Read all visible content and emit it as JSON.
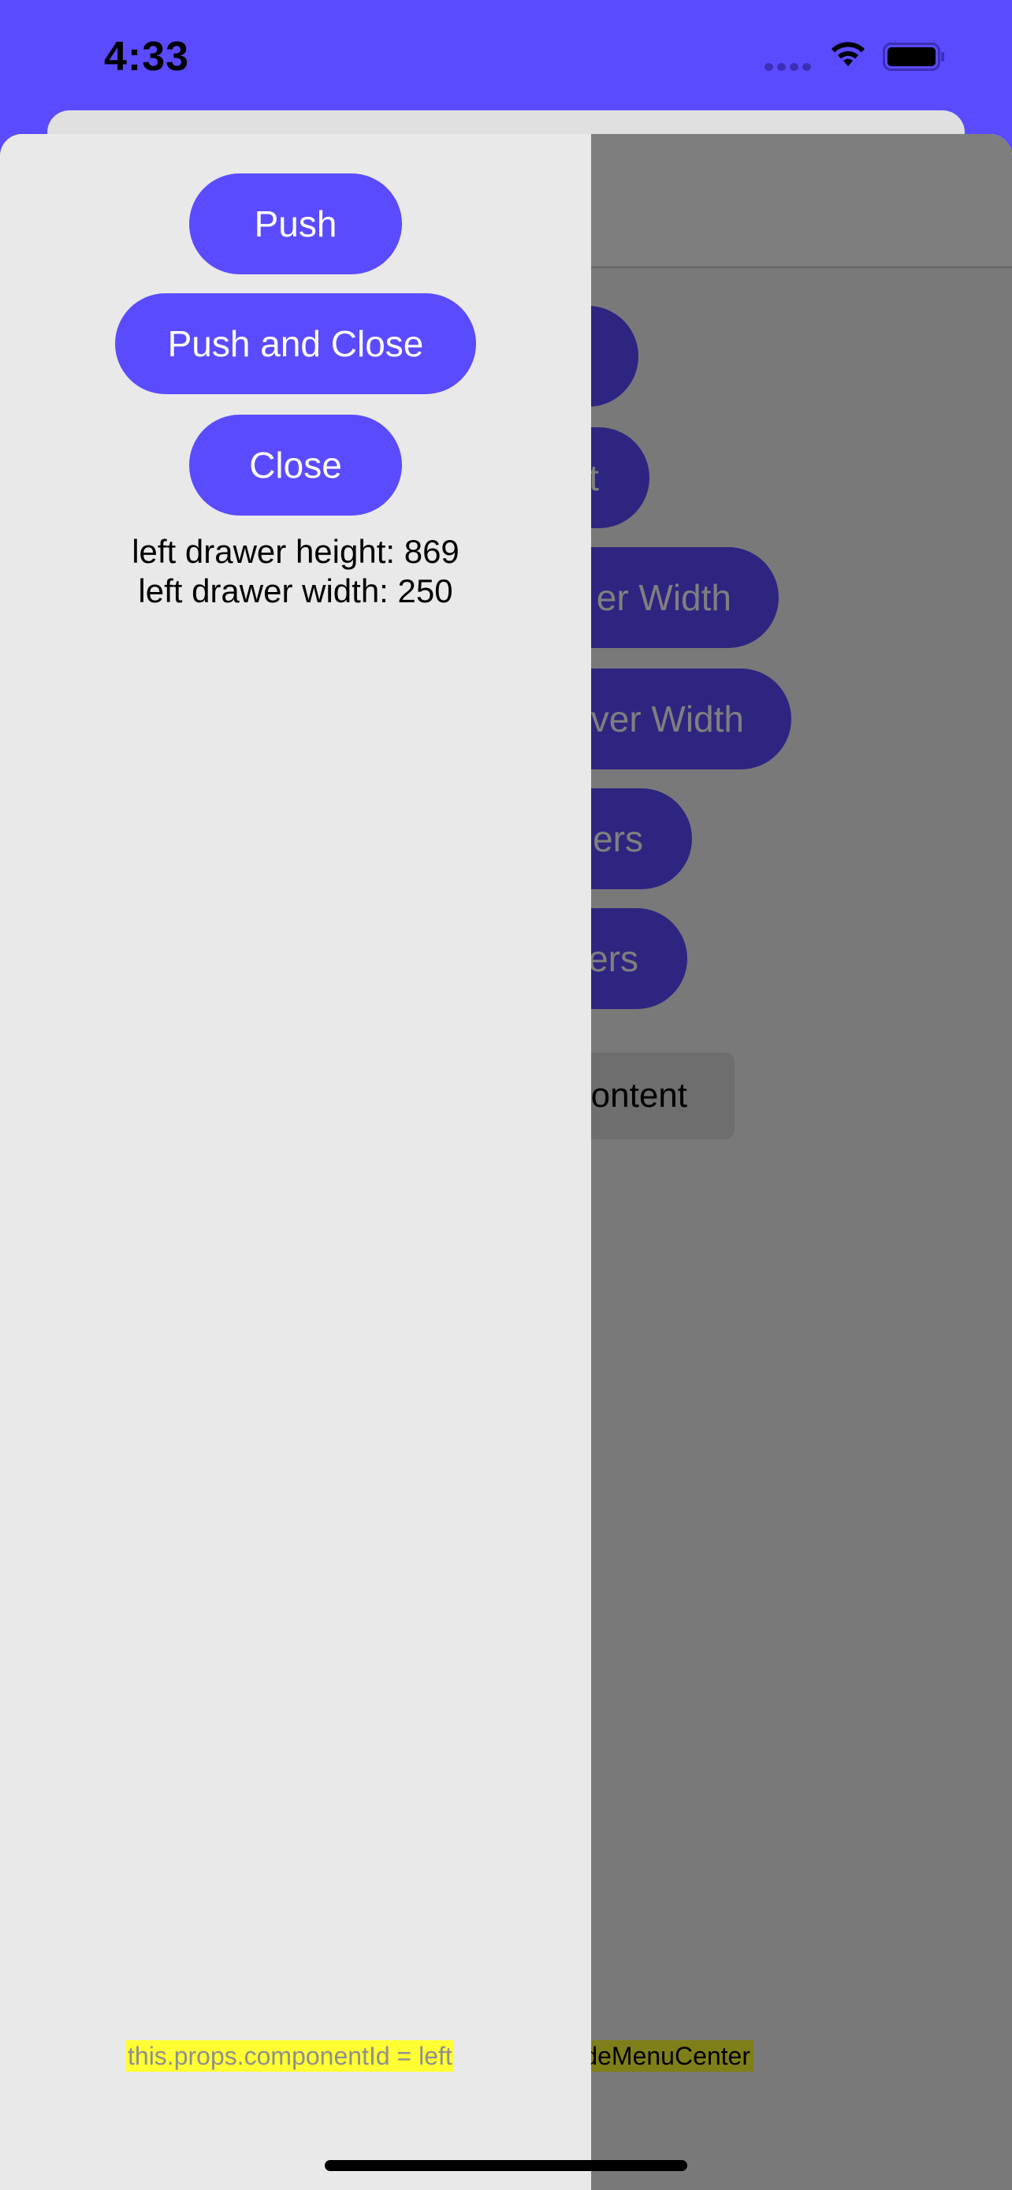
{
  "status_bar": {
    "time": "4:33"
  },
  "center": {
    "buttons": [
      {
        "label": "t"
      },
      {
        "label": "er Width"
      },
      {
        "label": "ver Width"
      },
      {
        "label": "ers"
      },
      {
        "label": "ers"
      }
    ],
    "content_button": "Content",
    "footer_label": "deMenuCenter"
  },
  "drawer": {
    "push_label": "Push",
    "push_and_close_label": "Push and Close",
    "close_label": "Close",
    "height_text": "left drawer height: 869",
    "width_text": "left drawer width: 250",
    "footer_label": "this.props.componentId = left"
  },
  "colors": {
    "accent": "#5b4bff",
    "drawer_bg": "#e9e9e9",
    "highlight": "#ffff33"
  }
}
